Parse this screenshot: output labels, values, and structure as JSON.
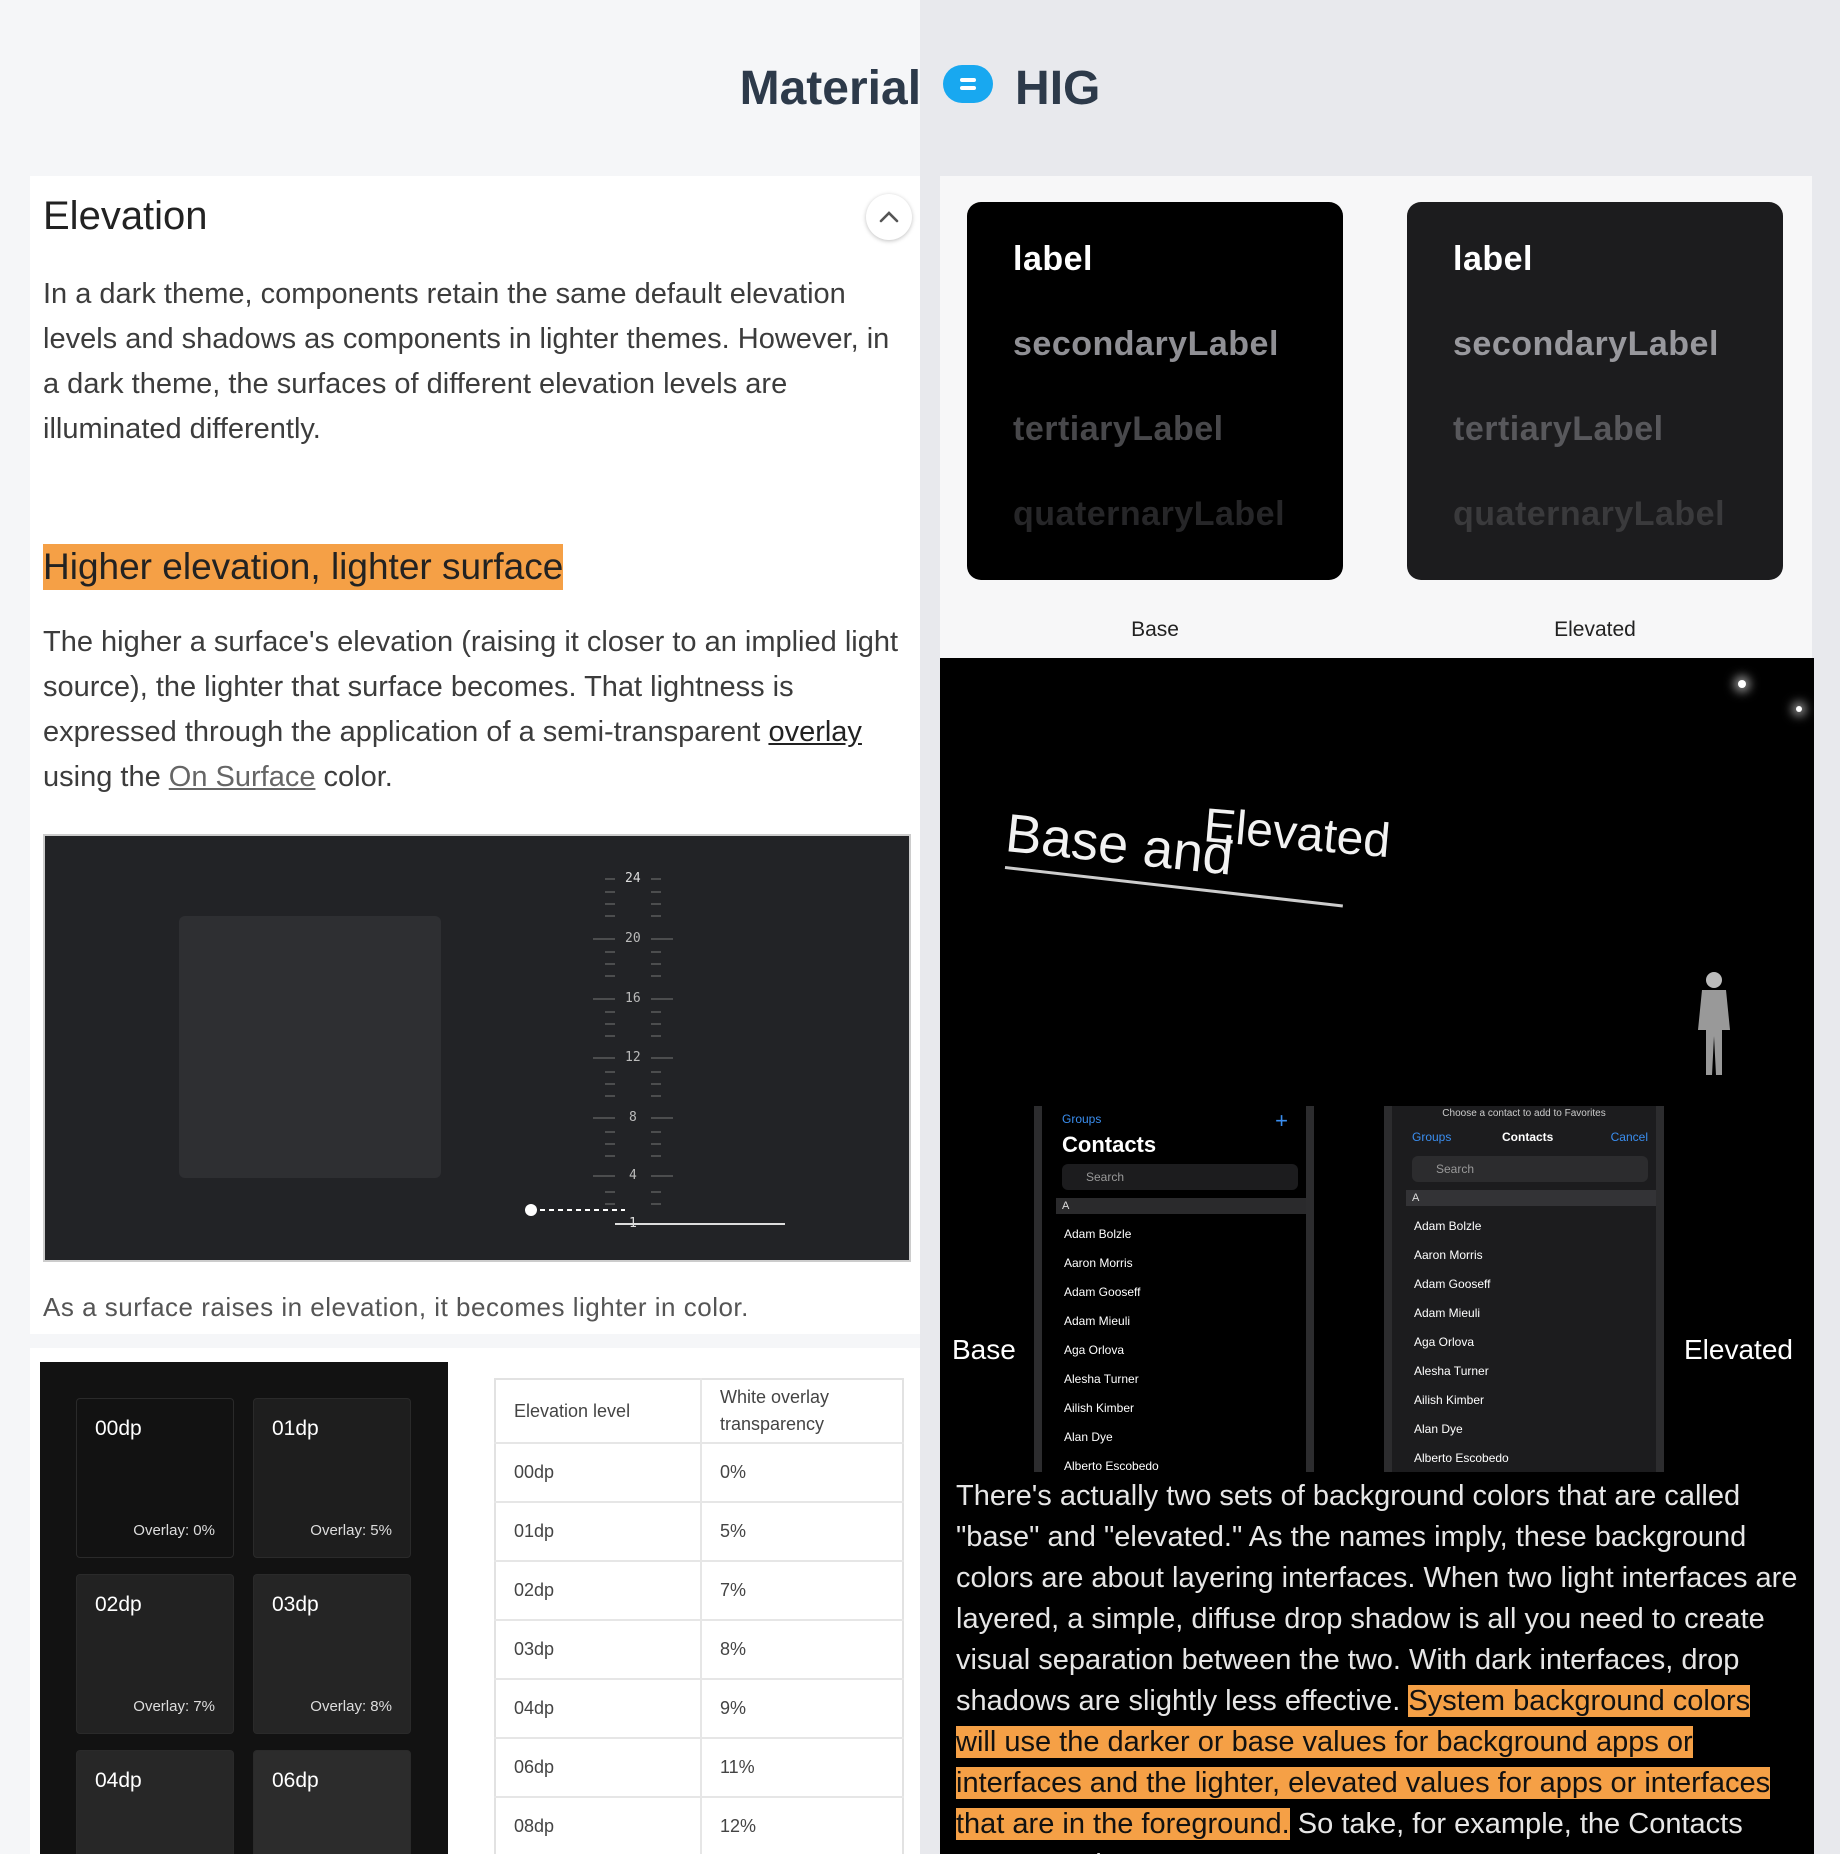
{
  "header": {
    "left": "Material",
    "right": "HIG"
  },
  "material": {
    "section_title": "Elevation",
    "intro": "In a dark theme, components retain the same default elevation levels and shadows as components in lighter themes. However, in a dark theme, the surfaces of different elevation levels are illuminated differently.",
    "subheading": "Higher elevation, lighter surface",
    "body_pre": "The higher a surface's elevation (raising it closer to an implied light source), the lighter that surface becomes. That lightness is expressed through the application of a semi-transparent ",
    "body_link1": "overlay",
    "body_mid": " using the ",
    "body_link2": "On Surface",
    "body_post": " color.",
    "scale_ticks": [
      "24",
      "20",
      "16",
      "12",
      "8",
      "4",
      "1"
    ],
    "caption": "As a surface raises in elevation, it becomes lighter in color.",
    "tiles": [
      {
        "name": "00dp",
        "overlay": "Overlay: 0%"
      },
      {
        "name": "01dp",
        "overlay": "Overlay: 5%"
      },
      {
        "name": "02dp",
        "overlay": "Overlay: 7%"
      },
      {
        "name": "03dp",
        "overlay": "Overlay: 8%"
      },
      {
        "name": "04dp",
        "overlay": ""
      },
      {
        "name": "06dp",
        "overlay": ""
      }
    ],
    "table": {
      "headers": [
        "Elevation level",
        "White overlay transparency"
      ],
      "rows": [
        [
          "00dp",
          "0%"
        ],
        [
          "01dp",
          "5%"
        ],
        [
          "02dp",
          "7%"
        ],
        [
          "03dp",
          "8%"
        ],
        [
          "04dp",
          "9%"
        ],
        [
          "06dp",
          "11%"
        ],
        [
          "08dp",
          "12%"
        ]
      ]
    }
  },
  "hig": {
    "label_names": [
      "label",
      "secondaryLabel",
      "tertiaryLabel",
      "quaternaryLabel"
    ],
    "box_captions": [
      "Base",
      "Elevated"
    ],
    "video_title_part1": "Base and",
    "video_title_part2": "Elevated",
    "side_labels": [
      "Base",
      "Elevated"
    ],
    "phone_base": {
      "groups": "Groups",
      "title": "Contacts",
      "search": "Search",
      "section": "A",
      "contacts": [
        "Adam Bolzle",
        "Aaron Morris",
        "Adam Gooseff",
        "Adam Mieuli",
        "Aga Orlova",
        "Alesha Turner",
        "Ailish Kimber",
        "Alan Dye",
        "Alberto Escobedo"
      ]
    },
    "phone_elevated": {
      "prompt": "Choose a contact to add to Favorites",
      "groups": "Groups",
      "title": "Contacts",
      "cancel": "Cancel",
      "search": "Search",
      "section": "A",
      "contacts": [
        "Adam Bolzle",
        "Aaron Morris",
        "Adam Gooseff",
        "Adam Mieuli",
        "Aga Orlova",
        "Alesha Turner",
        "Ailish Kimber",
        "Alan Dye",
        "Alberto Escobedo"
      ]
    },
    "quote_pre": "There's actually two sets of background colors that are called \"base\" and \"elevated.\" As the names imply, these background colors are about layering interfaces. When two light interfaces are layered, a simple, diffuse drop shadow is all you need to create visual separation between the two. With dark interfaces, drop shadows are slightly less effective. ",
    "quote_highlight": "System background colors will use the darker or base values for background apps or interfaces and the lighter, elevated values for apps or interfaces that are in the foreground.",
    "quote_post": " So take, for example, the Contacts app. It's using"
  },
  "colors": {
    "highlight": "#f5a046",
    "accent_badge": "#18a8f0",
    "link_blue": "#3a8ef0"
  }
}
